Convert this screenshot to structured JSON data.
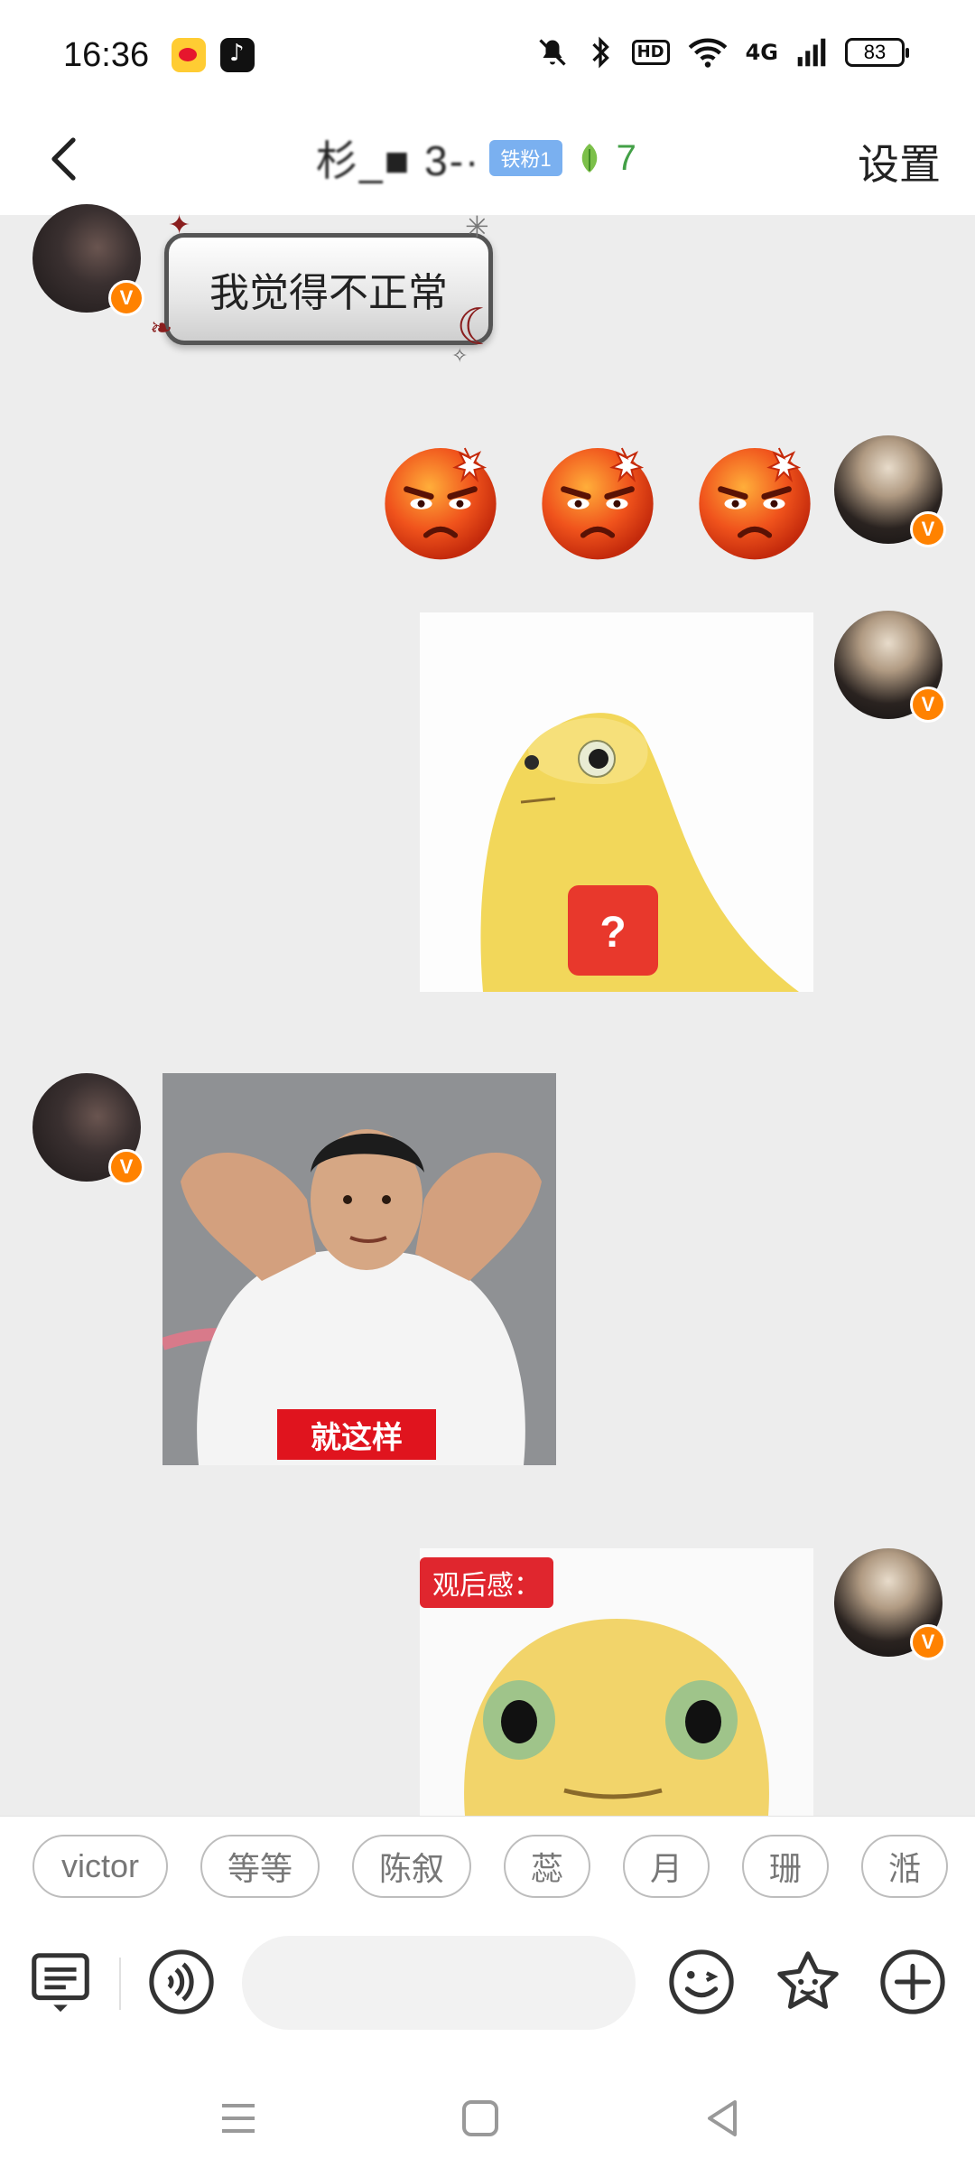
{
  "status_bar": {
    "time": "16:36",
    "battery": "83",
    "network": "4G",
    "hd": "HD",
    "icons": [
      "weibo-app-icon",
      "douyin-app-icon",
      "mute-icon",
      "bluetooth-icon",
      "hd-icon",
      "wifi-icon",
      "signal-icon",
      "battery-icon"
    ]
  },
  "header": {
    "title": "杉_■ 3-·",
    "fan_badge": "铁粉1",
    "fan_count": "7",
    "settings_label": "设置"
  },
  "messages": [
    {
      "side": "left",
      "type": "text",
      "text": "我觉得不正常"
    },
    {
      "side": "right",
      "type": "emoji",
      "emoji": "angry-face-emoji",
      "count": 3
    },
    {
      "side": "right",
      "type": "image",
      "image": "yellow-bird-question-sticker"
    },
    {
      "side": "left",
      "type": "image",
      "image": "man-sticker",
      "caption": "就这样"
    },
    {
      "side": "right",
      "type": "image",
      "image": "yellow-bird-closeup-sticker",
      "caption": "观后感："
    }
  ],
  "quick_replies": [
    "victor",
    "等等",
    "陈叙",
    "蕊",
    "月",
    "珊",
    "湉"
  ],
  "input": {
    "placeholder": "",
    "value": ""
  },
  "colors": {
    "accent_orange": "#ff8200",
    "fan_green": "#43a047",
    "label_red": "#e0141e",
    "chat_bg": "#ededed"
  }
}
